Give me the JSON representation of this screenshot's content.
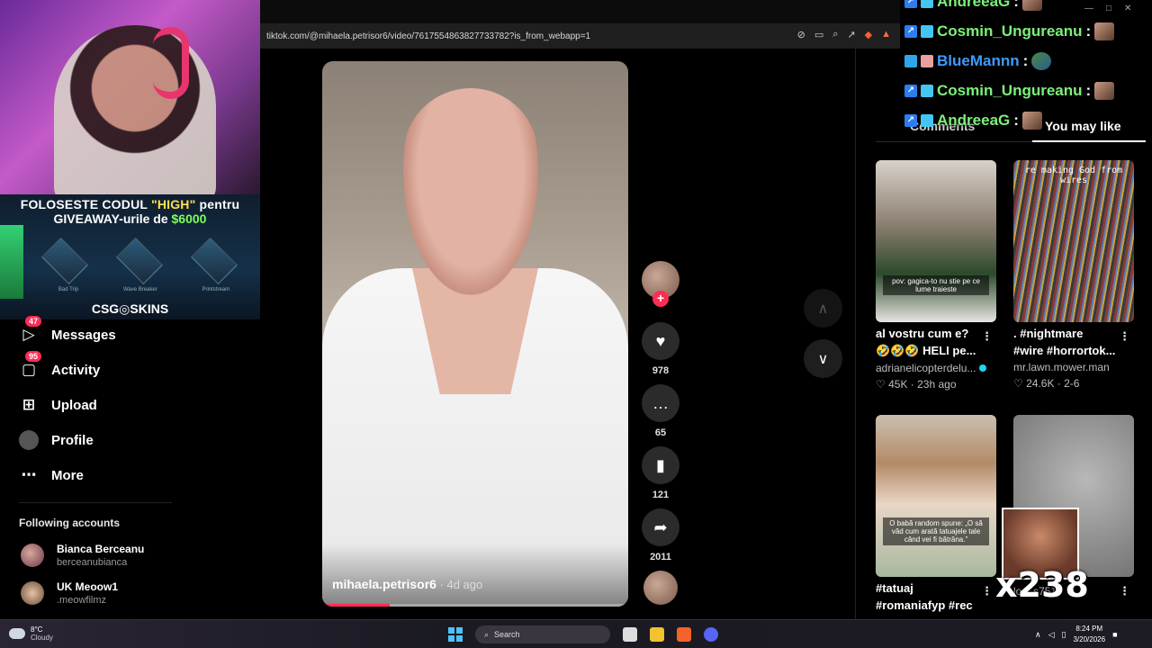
{
  "browser": {
    "url": "tiktok.com/@mihaela.petrisor6/video/7617554863827733782?is_from_webapp=1"
  },
  "promo": {
    "line1_prefix": "FOLOSESTE CODUL ",
    "line1_code": "\"HIGH\"",
    "line1_suffix": " pentru",
    "line2_prefix": "GIVEAWAY-urile de ",
    "line2_amount": "$6000",
    "items": [
      "Bad Trip",
      "Wave Breaker",
      "Printstream"
    ],
    "brand": "CSG◎SKINS"
  },
  "sidebar": {
    "items": [
      {
        "label": "Messages",
        "badge": "47",
        "icon": "paper-plane-icon"
      },
      {
        "label": "Activity",
        "badge": "95",
        "icon": "inbox-icon"
      },
      {
        "label": "Upload",
        "icon": "plus-square-icon"
      },
      {
        "label": "Profile",
        "icon": "avatar-icon"
      },
      {
        "label": "More",
        "icon": "ellipsis-icon"
      }
    ],
    "following_title": "Following accounts",
    "following": [
      {
        "name": "Bianca Berceanu",
        "handle": "berceanubianca"
      },
      {
        "name": "UK Meoow1",
        "handle": ".meowfilmz"
      }
    ]
  },
  "video": {
    "author": "mihaela.petrisor6",
    "ago": " · 4d ago",
    "progress": 0.22
  },
  "actions": {
    "likes": "978",
    "comments": "65",
    "saves": "121",
    "shares": "2011"
  },
  "right_panel": {
    "tab_comments": "Comments",
    "tab_like": "You may like",
    "cards": [
      {
        "title1": "al vostru cum e?",
        "title2": "🤣🤣🤣 HELI pe...",
        "author": "adrianelicopterdelu...",
        "verified": true,
        "likes": "45K",
        "ago": "23h ago",
        "caption": "pov: gagica-to nu stie pe ce lume traieste"
      },
      {
        "title1": ". #nightmare",
        "title2": "#wire #horrortok...",
        "author": "mr.lawn.mower.man",
        "verified": false,
        "likes": "24.6K",
        "ago": "2-6",
        "caption": "re making God from wires"
      },
      {
        "title1": "#tatuaj",
        "title2": "#romaniafyp #rec",
        "author": "",
        "caption": "O babă random spune: „O să văd cum arată tatuajele tale când vei fi bătrâna.”"
      },
      {
        "title1": "",
        "title2": "",
        "author": "looks751",
        "caption": ""
      }
    ]
  },
  "chat": [
    {
      "user": "AndreeaG",
      "color": "green"
    },
    {
      "user": "Cosmin_Ungureanu",
      "color": "green"
    },
    {
      "user": "BlueMannn",
      "color": "blue"
    },
    {
      "user": "Cosmin_Ungureanu",
      "color": "green"
    },
    {
      "user": "AndreeaG",
      "color": "green"
    }
  ],
  "combo": "x238",
  "taskbar": {
    "temp": "8°C",
    "weather": "Cloudy",
    "search": "Search",
    "time": "8:24 PM",
    "date": "3/20/2026"
  },
  "colors": {
    "accent": "#fe2c55",
    "chat_green": "#7df07a",
    "chat_blue": "#3d9bff"
  }
}
